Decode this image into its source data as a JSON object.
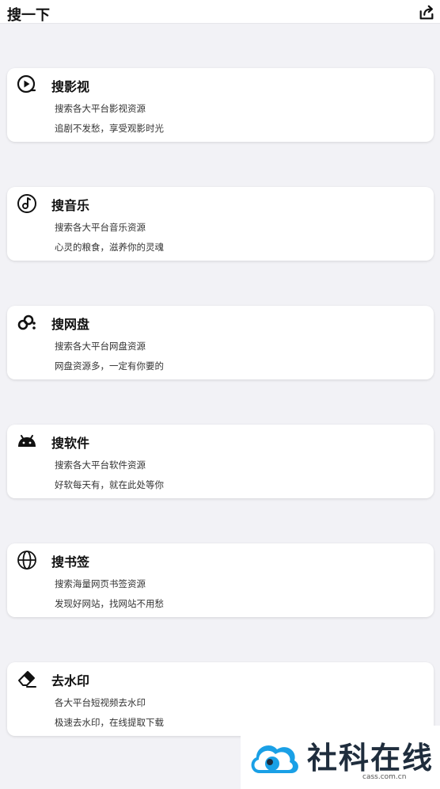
{
  "header": {
    "title": "搜一下",
    "share_icon": "share-icon"
  },
  "cards": [
    {
      "icon": "play-circle-icon",
      "title": "搜影视",
      "line1": "搜索各大平台影视资源",
      "line2": "追剧不发愁，享受观影时光"
    },
    {
      "icon": "music-note-icon",
      "title": "搜音乐",
      "line1": "搜索各大平台音乐资源",
      "line2": "心灵的粮食，滋养你的灵魂"
    },
    {
      "icon": "cloud-drive-icon",
      "title": "搜网盘",
      "line1": "搜索各大平台网盘资源",
      "line2": "网盘资源多，一定有你要的"
    },
    {
      "icon": "android-icon",
      "title": "搜软件",
      "line1": "搜索各大平台软件资源",
      "line2": "好软每天有，就在此处等你"
    },
    {
      "icon": "globe-icon",
      "title": "搜书签",
      "line1": "搜索海量网页书签资源",
      "line2": "发现好网站，找网站不用愁"
    },
    {
      "icon": "eraser-icon",
      "title": "去水印",
      "line1": "各大平台短视频去水印",
      "line2": "极速去水印，在线提取下载"
    }
  ],
  "watermark": {
    "text": "社科在线",
    "sub": "cass.com.cn",
    "colors": {
      "logo": "#1aa0e6",
      "text": "#1f2d3d"
    }
  }
}
